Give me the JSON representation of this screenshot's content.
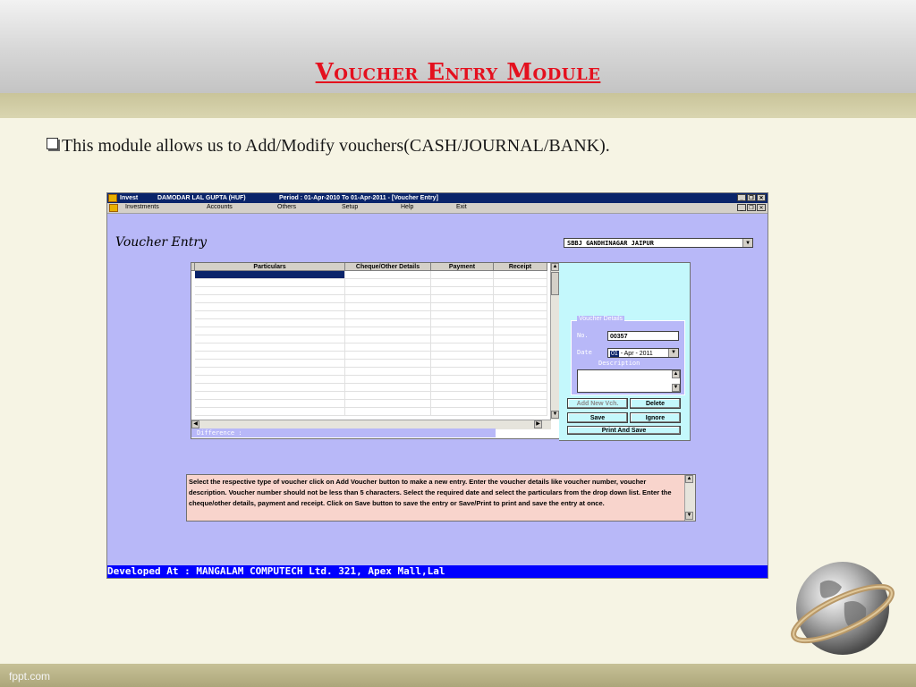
{
  "slide": {
    "title": "Voucher Entry Module",
    "bullet": "This module allows us to Add/Modify vouchers(CASH/JOURNAL/BANK).",
    "footer": "fppt.com"
  },
  "app": {
    "titlebar": {
      "app_name": "Invest",
      "company": "DAMODAR LAL GUPTA (HUF)",
      "period": "Period : 01-Apr-2010 To 01-Apr-2011 - [Voucher Entry]"
    },
    "menu": [
      "Investments",
      "Accounts",
      "Others",
      "Setup",
      "Help",
      "Exit"
    ],
    "form_title": "Voucher Entry",
    "bank_account": "SBBJ GANDHINAGAR JAIPUR",
    "grid": {
      "columns": [
        "Particulars",
        "Cheque/Other Details",
        "Payment",
        "Receipt"
      ],
      "difference_label": "Difference :"
    },
    "voucher_details": {
      "legend": "Voucher Details",
      "no_label": "No.",
      "no_value": "00357",
      "date_label": "Date",
      "date_day": "01",
      "date_rest": " - Apr - 2011",
      "description_label": "Description"
    },
    "buttons": {
      "add_new": "Add New Vch.",
      "delete": "Delete",
      "save": "Save",
      "ignore": "Ignore",
      "print_save": "Print And Save"
    },
    "info_text": "Select the respective type of voucher click on Add Voucher button to make a new entry. Enter the voucher details like voucher number, voucher description. Voucher number should not be less than 5 characters. Select the required date and select the particulars from the drop down list. Enter the cheque/other details, payment and receipt. Click on Save button to save the entry or Save/Print to print and save the entry at once.",
    "status_bar": "Developed At : MANGALAM COMPUTECH Ltd. 321, Apex Mall,Lal"
  }
}
